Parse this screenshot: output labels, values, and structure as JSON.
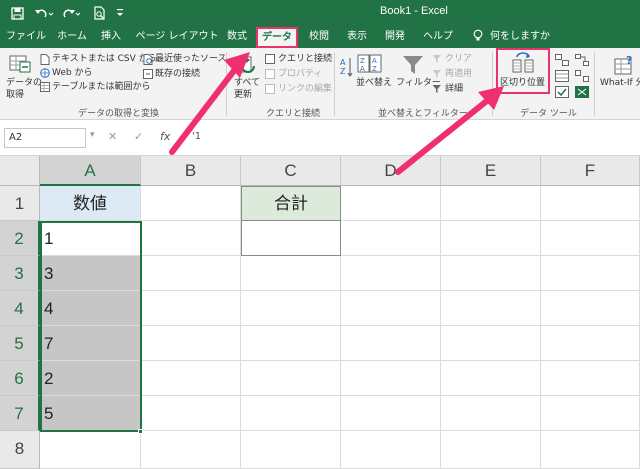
{
  "window": {
    "title": "Book1 - Excel"
  },
  "quick_access": {
    "save_icon": "save-icon",
    "undo_icon": "undo-icon",
    "redo_icon": "redo-icon",
    "print_preview_icon": "print-preview-icon",
    "customize_icon": "customize-arrow-icon"
  },
  "tabs": [
    {
      "label": "ファイル"
    },
    {
      "label": "ホーム"
    },
    {
      "label": "挿入"
    },
    {
      "label": "ページ レイアウト"
    },
    {
      "label": "数式"
    },
    {
      "label": "データ"
    },
    {
      "label": "校閲"
    },
    {
      "label": "表示"
    },
    {
      "label": "開発"
    },
    {
      "label": "ヘルプ"
    },
    {
      "label": "何をしますか"
    }
  ],
  "ribbon": {
    "get_data_line1": "データの",
    "get_data_line2": "取得",
    "from_text_csv": "テキストまたは CSV から",
    "from_web": "Web から",
    "from_table": "テーブルまたは範囲から",
    "recent_sources": "最近使ったソース",
    "existing_connections": "既存の接続",
    "group_get_transform": "データの取得と変換",
    "refresh_all_line1": "すべて",
    "refresh_all_line2": "更新",
    "queries_connections": "クエリと接続",
    "properties": "プロパティ",
    "edit_links": "リンクの編集",
    "group_queries": "クエリと接続",
    "sort": "並べ替え",
    "filter": "フィルター",
    "clear": "クリア",
    "reapply": "再適用",
    "advanced": "詳細",
    "group_sort_filter": "並べ替えとフィルター",
    "text_to_columns": "区切り位置",
    "group_data_tools": "データ ツール",
    "what_if": "What-If 分"
  },
  "formula_bar": {
    "name_box": "A2",
    "cancel_symbol": "✕",
    "enter_symbol": "✓",
    "fx_symbol": "fx",
    "value": "'1"
  },
  "grid": {
    "columns": [
      "A",
      "B",
      "C",
      "D",
      "E",
      "F"
    ],
    "rows": [
      "1",
      "2",
      "3",
      "4",
      "5",
      "6",
      "7",
      "8"
    ],
    "A1": "数値",
    "C1": "合計",
    "values": [
      "1",
      "3",
      "4",
      "7",
      "2",
      "5"
    ]
  },
  "colors": {
    "excel_green": "#217346",
    "highlight_pink": "#e8336b",
    "arrow_pink": "#f0306e"
  }
}
